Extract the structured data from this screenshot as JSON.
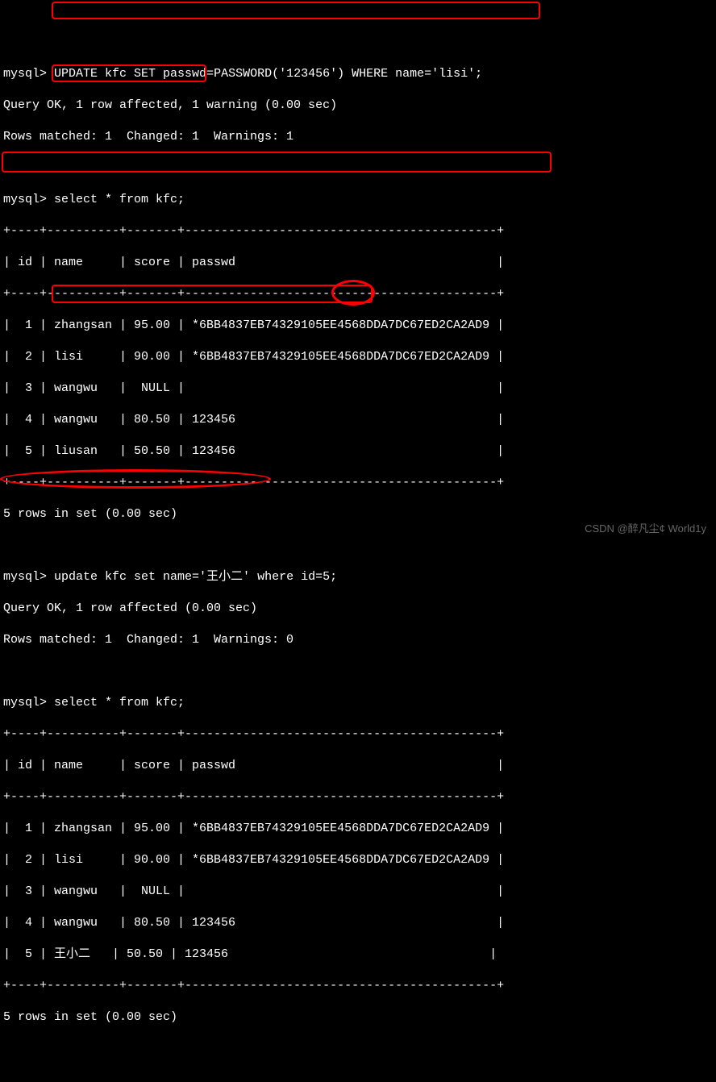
{
  "prompt": "mysql>",
  "cmd1": "UPDATE kfc SET passwd=PASSWORD('123456') WHERE name='lisi';",
  "res1_1": "Query OK, 1 row affected, 1 warning (0.00 sec)",
  "res1_2": "Rows matched: 1  Changed: 1  Warnings: 1",
  "cmd2": "select * from kfc;",
  "table_sep": "+----+----------+-------+-------------------------------------------+",
  "table_hdr": "| id | name     | score | passwd                                    |",
  "t1_rows": [
    "|  1 | zhangsan | 95.00 | *6BB4837EB74329105EE4568DDA7DC67ED2CA2AD9 |",
    "|  2 | lisi     | 90.00 | *6BB4837EB74329105EE4568DDA7DC67ED2CA2AD9 |",
    "|  3 | wangwu   |  NULL |                                           |",
    "|  4 | wangwu   | 80.50 | 123456                                    |",
    "|  5 | liusan   | 50.50 | 123456                                    |"
  ],
  "rows_msg": "5 rows in set (0.00 sec)",
  "cmd3": "update kfc set name='王小二' where id=5;",
  "res3_1": "Query OK, 1 row affected (0.00 sec)",
  "res3_2": "Rows matched: 1  Changed: 1  Warnings: 0",
  "cmd4": "select * from kfc;",
  "t2_rows": [
    "|  1 | zhangsan | 95.00 | *6BB4837EB74329105EE4568DDA7DC67ED2CA2AD9 |",
    "|  2 | lisi     | 90.00 | *6BB4837EB74329105EE4568DDA7DC67ED2CA2AD9 |",
    "|  3 | wangwu   |  NULL |                                           |",
    "|  4 | wangwu   | 80.50 | 123456                                    |",
    "|  5 | 王小二   | 50.50 | 123456                                    |"
  ],
  "watermark": "CSDN @醉凡尘¢ World1y"
}
